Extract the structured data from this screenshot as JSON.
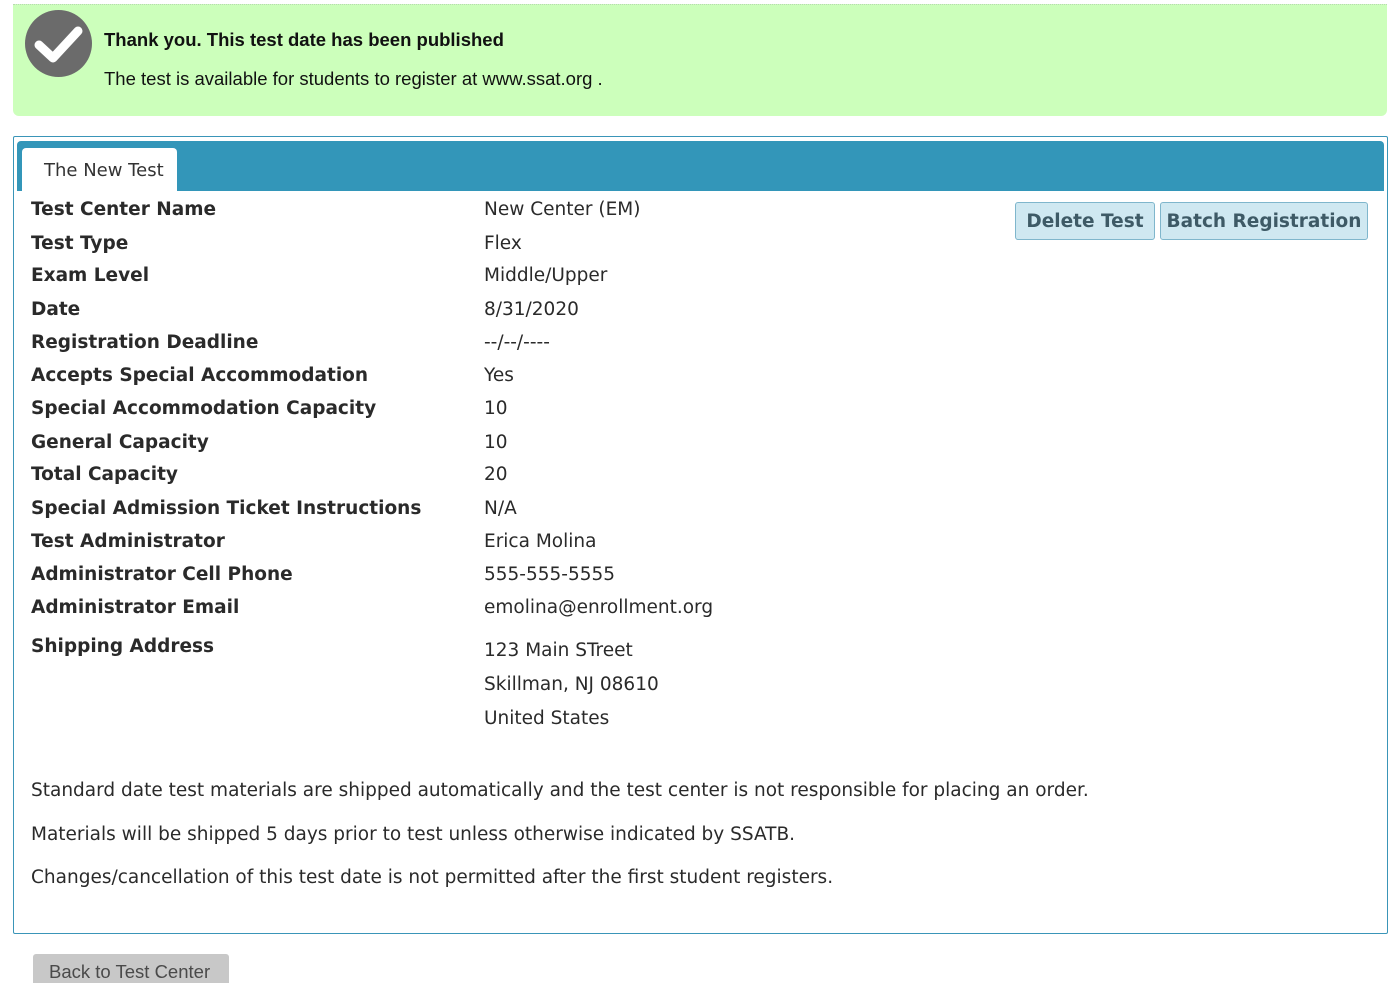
{
  "banner": {
    "title": "Thank you. This test date has been published",
    "subtitle": "The test is available for students to register at www.ssat.org ."
  },
  "tab": {
    "label": "The New Test"
  },
  "actions": {
    "delete_label": "Delete Test",
    "batch_label": "Batch Registration"
  },
  "details": [
    {
      "label": "Test Center Name",
      "value": "New Center (EM)"
    },
    {
      "label": "Test Type",
      "value": "Flex"
    },
    {
      "label": "Exam Level",
      "value": "Middle/Upper"
    },
    {
      "label": "Date",
      "value": "8/31/2020"
    },
    {
      "label": "Registration Deadline",
      "value": "--/--/----"
    },
    {
      "label": "Accepts Special Accommodation",
      "value": "Yes"
    },
    {
      "label": "Special Accommodation Capacity",
      "value": "10"
    },
    {
      "label": "General Capacity",
      "value": "10"
    },
    {
      "label": "Total Capacity",
      "value": "20"
    },
    {
      "label": "Special Admission Ticket Instructions",
      "value": "N/A"
    },
    {
      "label": "Test Administrator",
      "value": "Erica Molina"
    },
    {
      "label": "Administrator Cell Phone",
      "value": "555-555-5555"
    },
    {
      "label": "Administrator Email",
      "value": "emolina@enrollment.org"
    }
  ],
  "shipping": {
    "label": "Shipping Address",
    "lines": [
      "123 Main STreet",
      "Skillman, NJ 08610",
      "United States"
    ]
  },
  "notes": [
    "Standard date test materials are shipped automatically and the test center is not responsible for placing an order.",
    "Materials will be shipped 5 days prior to test unless otherwise indicated by SSATB.",
    "Changes/cancellation of this test date is not permitted after the first student registers."
  ],
  "footer": {
    "back_label": "Back to Test Center"
  },
  "colors": {
    "banner_bg": "#ccffbb",
    "tab_bar": "#3396b9",
    "button_bg": "#cfe8f1"
  }
}
